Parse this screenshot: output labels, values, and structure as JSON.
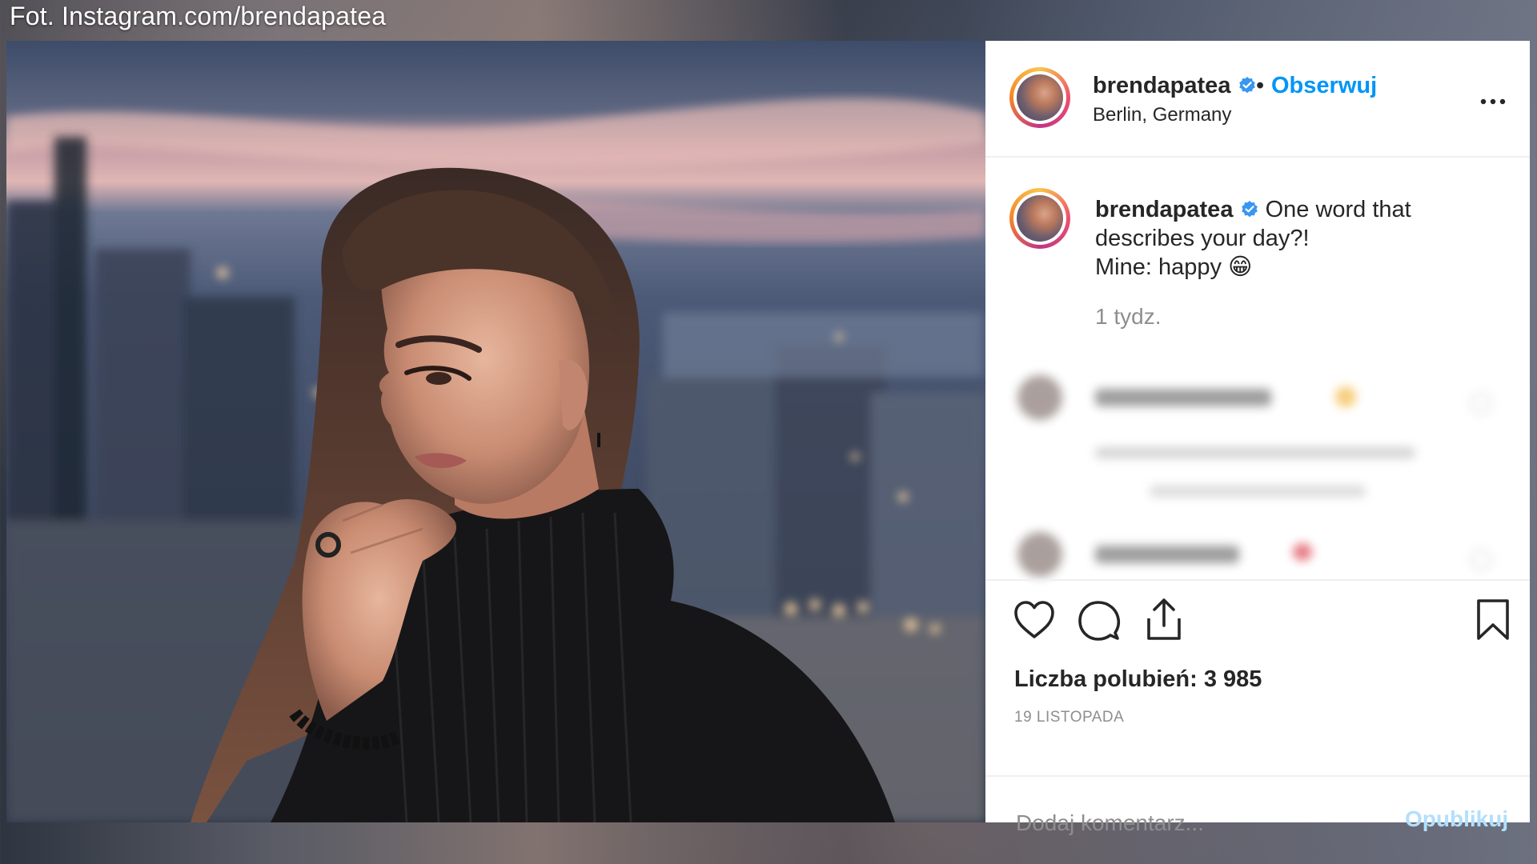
{
  "credit": "Fot. Instagram.com/brendapatea",
  "post": {
    "username": "brendapatea",
    "verified_icon": "verified-badge-icon",
    "separator": "•",
    "follow_label": "Obserwuj",
    "location": "Berlin, Germany",
    "more_icon": "more-options-icon",
    "caption_username": "brendapatea",
    "caption_line1": "One word that",
    "caption_line2": "describes your day?!",
    "caption_line3": "Mine: happy",
    "caption_emoji": "😁",
    "time_ago": "1 tydz.",
    "likes": "Liczba polubień: 3 985",
    "date": "19 LISTOPADA",
    "comment_placeholder": "Dodaj komentarz...",
    "publish_label": "Opublikuj"
  },
  "colors": {
    "accent": "#0095f6",
    "publish_disabled": "#b2dffc",
    "text": "#262626",
    "muted": "#8e8e8e"
  },
  "icons": [
    "heart-icon",
    "comment-icon",
    "share-icon",
    "bookmark-icon"
  ]
}
